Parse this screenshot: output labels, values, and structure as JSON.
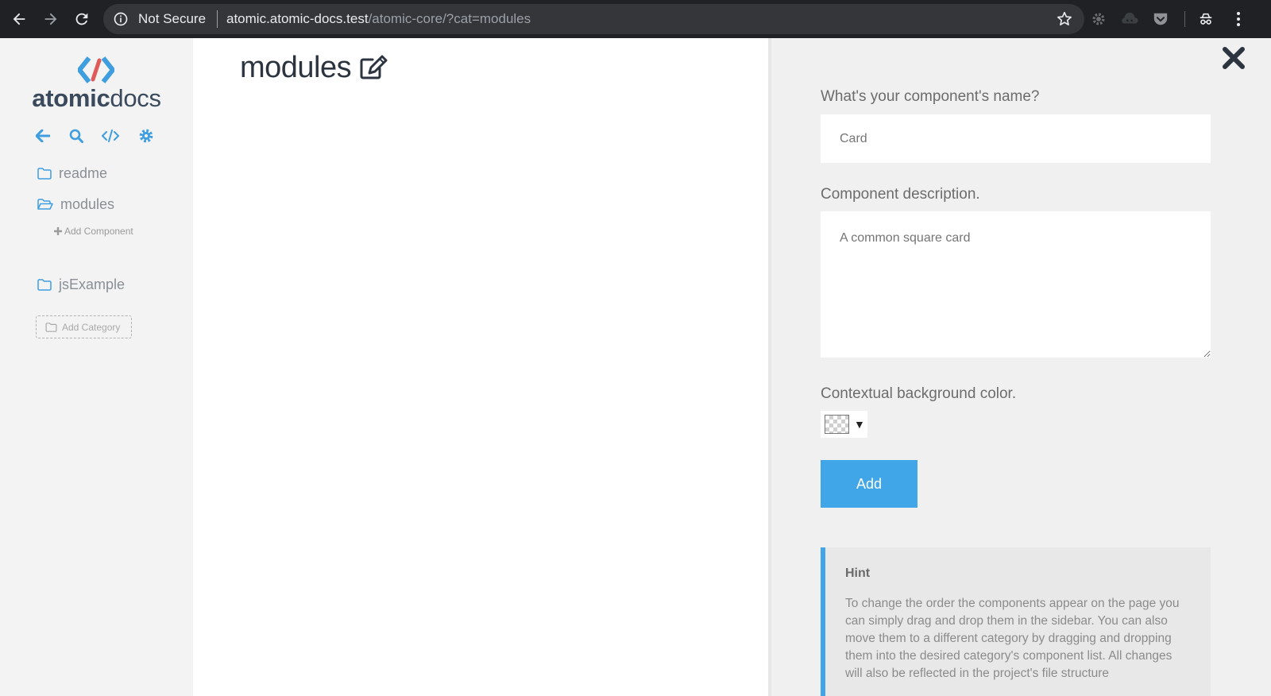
{
  "browser": {
    "security_label": "Not Secure",
    "url_host": "atomic.atomic-docs.test",
    "url_path": "/atomic-core/?cat=modules"
  },
  "sidebar": {
    "brand_bold": "atomic",
    "brand_light": "docs",
    "categories": [
      {
        "label": "readme",
        "icon": "folder-icon"
      },
      {
        "label": "modules",
        "icon": "folder-open-icon"
      },
      {
        "label": "jsExample",
        "icon": "folder-icon"
      }
    ],
    "add_component_label": "Add Component",
    "add_category_label": "Add Category"
  },
  "main": {
    "title": "modules"
  },
  "panel": {
    "name_label": "What's your component's name?",
    "name_placeholder": "Card",
    "desc_label": "Component description.",
    "desc_placeholder": "A common square card",
    "bg_label": "Contextual background color.",
    "add_button": "Add",
    "hint_title": "Hint",
    "hint_body": "To change the order the components appear on the page you can simply drag and drop them in the sidebar. You can also move them to a different category by dragging and dropping them into the desired category's component list. All changes will also be reflected in the project's file structure"
  },
  "colors": {
    "accent": "#41a6e8",
    "logo_blue": "#3e9ee0",
    "logo_red": "#e05a5a",
    "brand_text": "#3a4a5c"
  }
}
